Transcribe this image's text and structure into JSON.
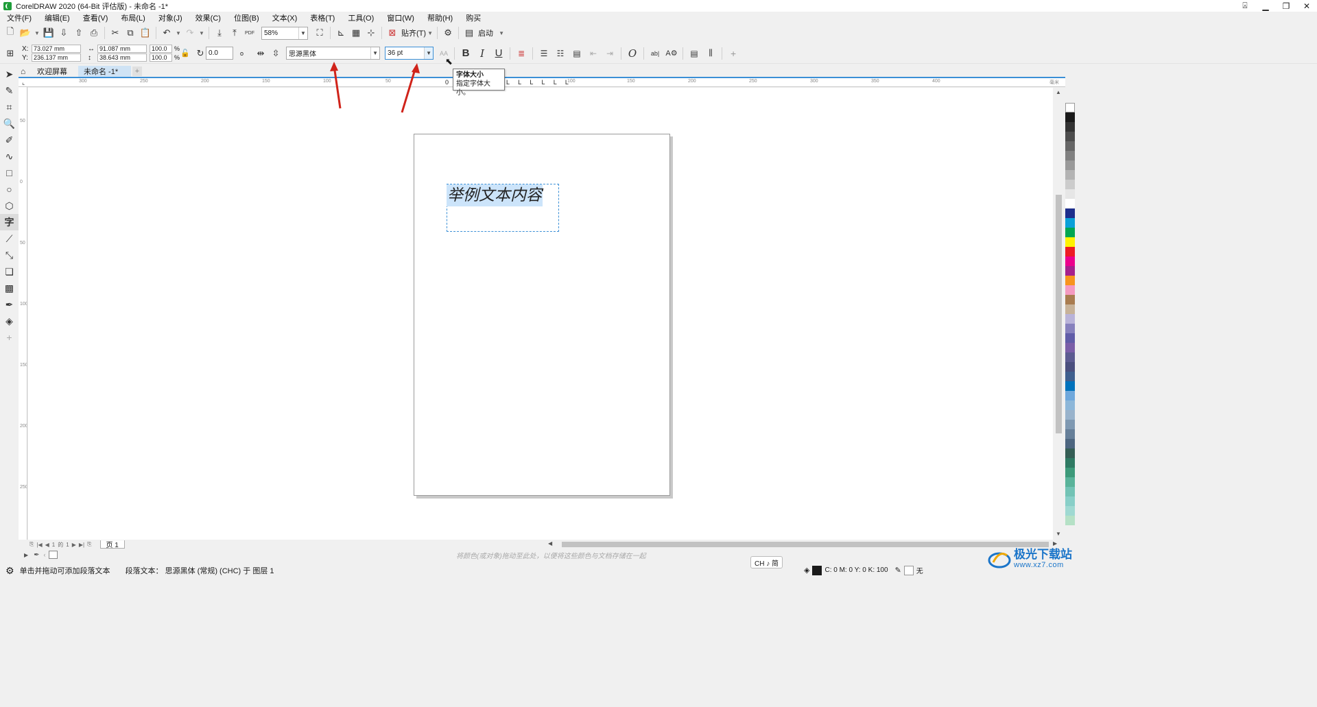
{
  "window": {
    "title": "CorelDRAW 2020 (64-Bit 评估版) - 未命名 -1*",
    "controls": [
      "minimize",
      "restore",
      "close"
    ]
  },
  "menu": [
    "文件(F)",
    "编辑(E)",
    "查看(V)",
    "布局(L)",
    "对象(J)",
    "效果(C)",
    "位图(B)",
    "文本(X)",
    "表格(T)",
    "工具(O)",
    "窗口(W)",
    "帮助(H)",
    "购买"
  ],
  "toolbar": {
    "zoom": "58%",
    "snap_label": "贴齐(T)",
    "launch_label": "启动",
    "pdf_label": "PDF"
  },
  "propbar": {
    "x_label": "X:",
    "y_label": "Y:",
    "x_value": "73.027 mm",
    "y_value": "236.137 mm",
    "w_value": "91.087 mm",
    "h_value": "38.643 mm",
    "scale_w": "100.0",
    "scale_h": "100.0",
    "pct": "%",
    "rotation": "0.0",
    "degree": "o",
    "font_name": "思源黑体",
    "font_size": "36 pt",
    "bold": "B",
    "italic": "I",
    "underline": "U",
    "ab_label": "ab|",
    "aa_label": "AA"
  },
  "tabs": {
    "welcome": "欢迎屏幕",
    "document": "未命名 -1*"
  },
  "ruler_h": [
    "300",
    "250",
    "200",
    "150",
    "100",
    "50",
    "0",
    "50",
    "100",
    "150",
    "200",
    "250",
    "300",
    "350",
    "400"
  ],
  "ruler_v": [
    "50",
    "0",
    "50",
    "100",
    "150",
    "200",
    "250"
  ],
  "ruler_unit": "毫米",
  "canvas": {
    "sample_text": "举例文本内容"
  },
  "tooltip": {
    "title": "字体大小",
    "body": "指定字体大小。"
  },
  "page_nav": {
    "current": "1",
    "of": "的",
    "total": "1",
    "page_tab": "页 1"
  },
  "hint": "将颜色(或对象)拖动至此处，以便将这些颜色与文档存储在一起",
  "status": {
    "left": "单击并拖动可添加段落文本",
    "mid": "段落文本： 思源黑体 (常规) (CHC) 于 图层 1",
    "ime": "CH ♪ 简",
    "fill_cmyk": "C: 0 M: 0 Y: 0 K: 100",
    "outline": "无"
  },
  "palette_colors": [
    "#ffffff",
    "#1a1a1a",
    "#333333",
    "#4d4d4d",
    "#666666",
    "#808080",
    "#999999",
    "#b3b3b3",
    "#cccccc",
    "#e6e6e6",
    "#ffffff",
    "#1d2e8c",
    "#0aa0d8",
    "#00a651",
    "#fff200",
    "#ed1c24",
    "#ec008c",
    "#a6218d",
    "#f7941d",
    "#f49ac1",
    "#a97c50",
    "#c7b299",
    "#b9b3d9",
    "#8781bd",
    "#605ca8",
    "#7a5ea8",
    "#5c5b91",
    "#4a4f7e",
    "#3f5f8e",
    "#0072bc",
    "#6fa8dc",
    "#8db7d9",
    "#99b3cc",
    "#7f99b2",
    "#667f99",
    "#4d6680",
    "#355e55",
    "#2f7a63",
    "#3d9a7a",
    "#59b39a",
    "#72c3b5",
    "#88cfc8",
    "#9fd9d2",
    "#b5e1c6"
  ],
  "watermark": {
    "line1": "极光下载站",
    "line2": "www.xz7.com"
  },
  "annotation_color": "#d0231a"
}
